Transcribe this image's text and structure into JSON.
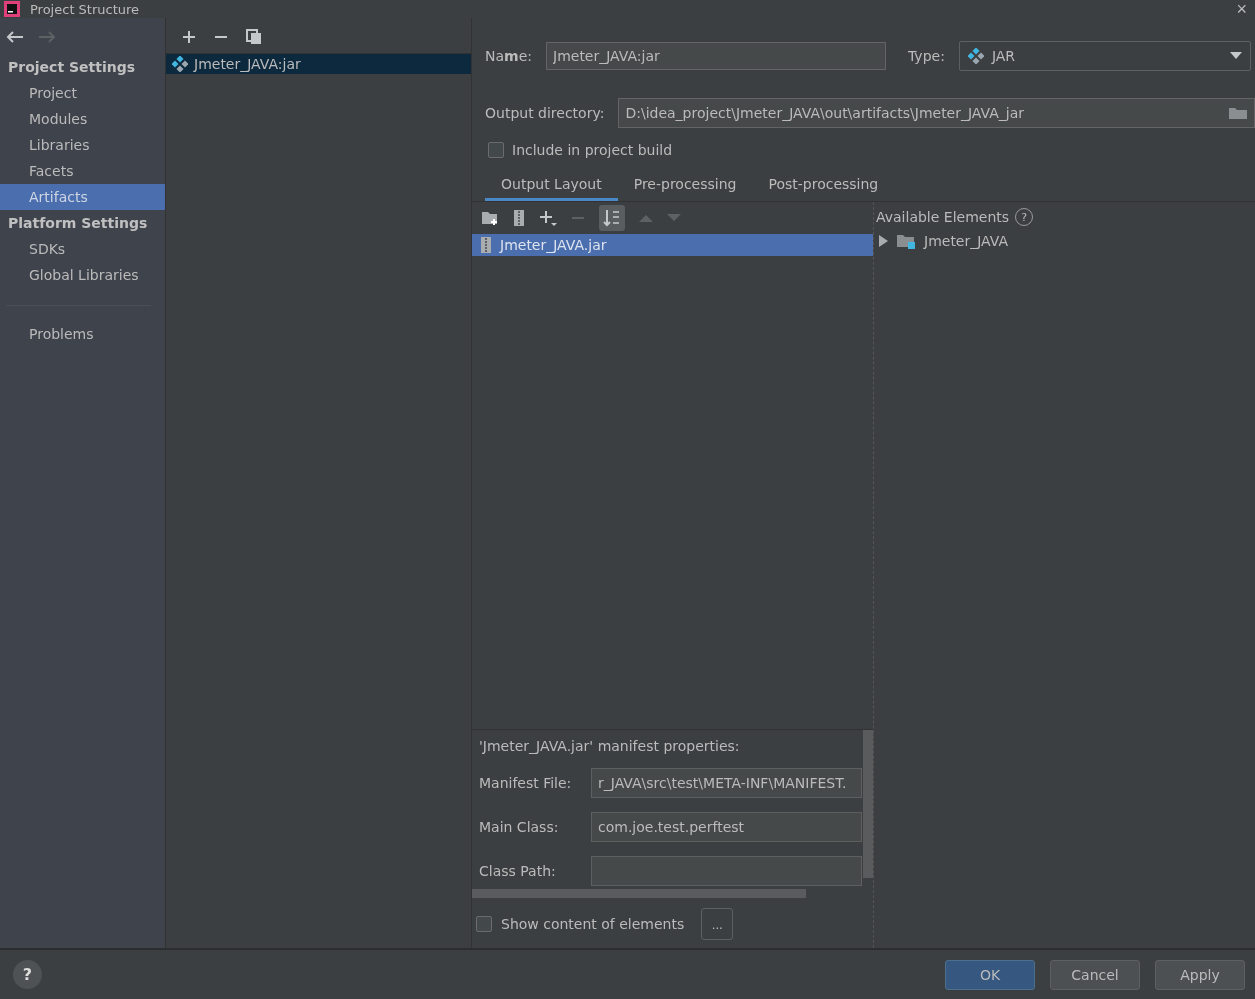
{
  "window": {
    "title": "Project Structure",
    "close": "×"
  },
  "sidebar": {
    "sections": [
      {
        "heading": "Project Settings",
        "items": [
          {
            "label": "Project",
            "selected": false
          },
          {
            "label": "Modules",
            "selected": false
          },
          {
            "label": "Libraries",
            "selected": false
          },
          {
            "label": "Facets",
            "selected": false
          },
          {
            "label": "Artifacts",
            "selected": true
          }
        ]
      },
      {
        "heading": "Platform Settings",
        "items": [
          {
            "label": "SDKs",
            "selected": false
          },
          {
            "label": "Global Libraries",
            "selected": false
          }
        ]
      }
    ],
    "footer_items": [
      {
        "label": "Problems",
        "selected": false
      }
    ]
  },
  "artifacts": [
    {
      "label": "Jmeter_JAVA:jar",
      "selected": true
    }
  ],
  "form": {
    "name_label": "Na**m**e:",
    "name_value": "Jmeter_JAVA:jar",
    "type_label": "Type:",
    "type_value": "JAR",
    "output_label": "Output directory:",
    "output_value": "D:\\idea_project\\Jmeter_JAVA\\out\\artifacts\\Jmeter_JAVA_jar",
    "include_build": {
      "label": "Include in project build",
      "checked": false
    }
  },
  "tabs": [
    {
      "label": "Output Layout",
      "selected": true
    },
    {
      "label": "Pre-processing",
      "selected": false
    },
    {
      "label": "Post-processing",
      "selected": false
    }
  ],
  "output_tree": [
    {
      "label": "Jmeter_JAVA.jar",
      "selected": true
    }
  ],
  "available": {
    "label": "Available Elements",
    "help": "?",
    "items": [
      {
        "label": "Jmeter_JAVA",
        "expanded": false
      }
    ]
  },
  "manifest": {
    "heading": "'Jmeter_JAVA.jar' manifest properties:",
    "fields": [
      {
        "label": "Manifest File:",
        "value": "r_JAVA\\src\\test\\META-INF\\MANIFEST."
      },
      {
        "label": "Main Class:",
        "value": "com.joe.test.perftest"
      },
      {
        "label": "Class Path:"
      }
    ]
  },
  "show_content": {
    "label": "Show content of elements",
    "checked": false,
    "button": "..."
  },
  "footer": {
    "help": "?",
    "buttons": [
      {
        "label": "OK",
        "kind": "primary"
      },
      {
        "label": "Cancel",
        "kind": "normal"
      },
      {
        "label": "Apply",
        "kind": "normal"
      }
    ]
  }
}
